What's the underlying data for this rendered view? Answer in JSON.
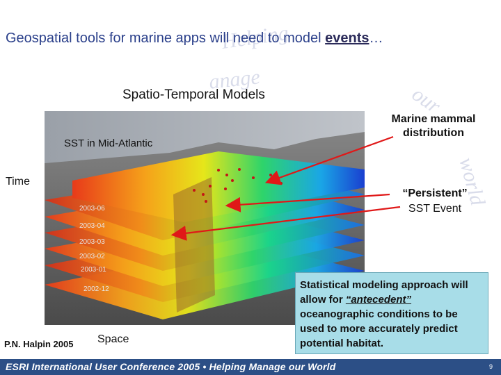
{
  "title": {
    "prefix": "Geospatial tools for marine apps will need to model ",
    "emphasis": "events",
    "suffix": "…"
  },
  "watermark": [
    "Helping",
    "manage",
    "our",
    "world"
  ],
  "subtitle": "Spatio-Temporal Models",
  "figure": {
    "sst_label": "SST in Mid-Atlantic",
    "time_axis": "Time",
    "space_axis": "Space",
    "layer_dates": [
      "2003-06",
      "2003-04",
      "2003-03",
      "2003-02",
      "2003-01",
      "2002-12"
    ]
  },
  "annotations": {
    "marine_mammal": "Marine mammal distribution",
    "persistent_quote": "“Persistent”",
    "persistent_rest": "SST Event"
  },
  "callout": {
    "before": "Statistical modeling approach will allow for  ",
    "emphasis": "“antecedent”",
    "after": " oceanographic  conditions to be used to more accurately predict potential habitat."
  },
  "credit": "P.N. Halpin 2005",
  "footer": {
    "text": "ESRI International User Conference 2005 • Helping Manage our World",
    "page": "9"
  },
  "colors": {
    "title": "#2a3f8a",
    "footer": "#2c4f86",
    "callout": "#a8dde8",
    "arrow": "#e01818"
  }
}
